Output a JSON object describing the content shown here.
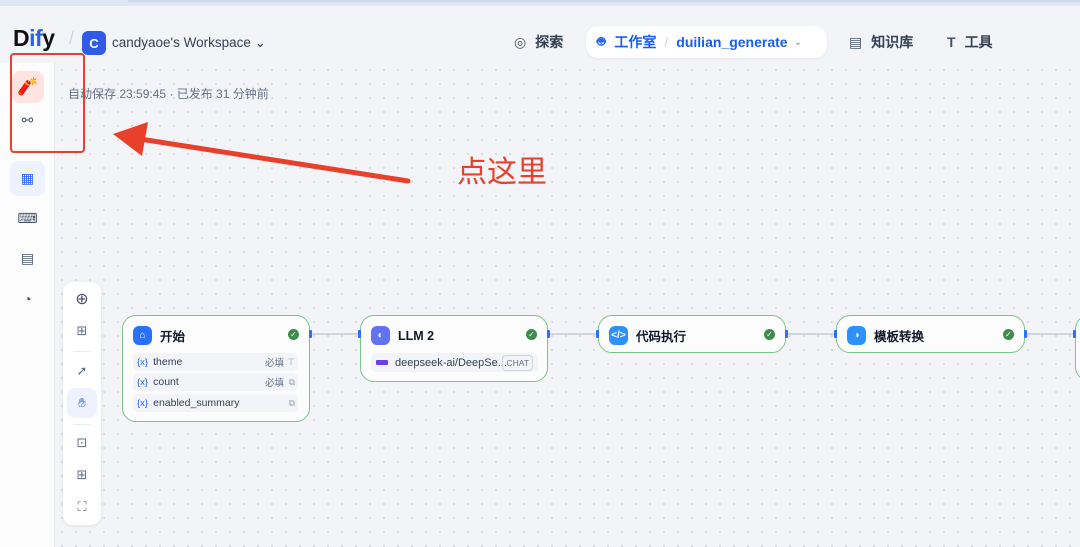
{
  "header": {
    "logo": {
      "a": "D",
      "b": "if",
      "c": "y"
    },
    "workspace_initial": "C",
    "workspace_name": "candyaoe's Workspace",
    "nav": {
      "explore": "探索",
      "studio": "工作室",
      "app_name": "duilian_generate",
      "knowledge": "知识库",
      "tools": "工具"
    }
  },
  "status": {
    "autosave": "自动保存 23:59:45 · 已发布 31 分钟前"
  },
  "annotation": {
    "hint": "点这里",
    "color": "#e8402a"
  },
  "nodes": {
    "start": {
      "title": "开始",
      "vars": [
        {
          "name": "theme",
          "required": "必填"
        },
        {
          "name": "count",
          "required": "必填"
        },
        {
          "name": "enabled_summary",
          "required": ""
        }
      ]
    },
    "llm": {
      "title": "LLM 2",
      "model": "deepseek-ai/DeepSe...",
      "mode": "CHAT"
    },
    "code": {
      "title": "代码执行"
    },
    "template": {
      "title": "模板转换"
    }
  },
  "var_icon": "{x}",
  "colors": {
    "accent": "#155eef",
    "success": "#3d8c4c",
    "node_border": "#7cc48a"
  }
}
